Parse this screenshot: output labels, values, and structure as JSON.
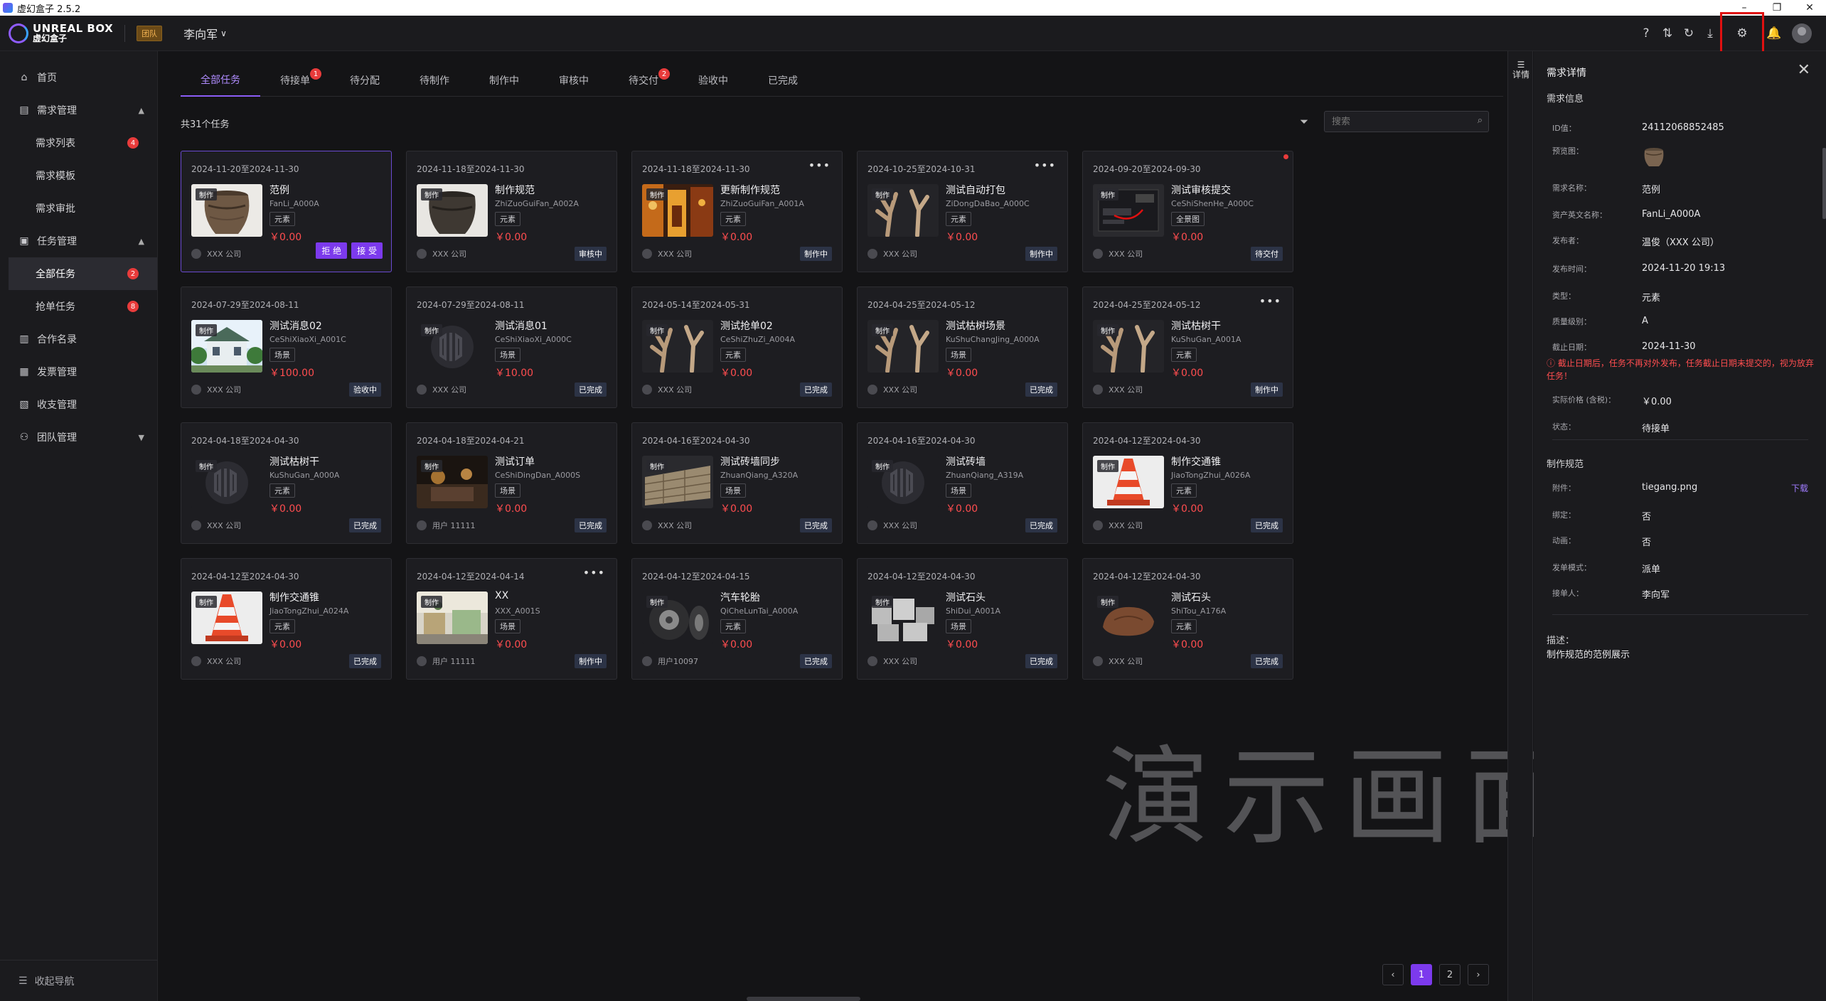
{
  "window": {
    "title": "虚幻盒子 2.5.2"
  },
  "header": {
    "logo_line1": "UNREAL BOX",
    "logo_line2": "虚幻盒子",
    "team_badge": "团队",
    "user_name": "李向军",
    "icons": [
      "help-icon",
      "sort-icon",
      "refresh-icon",
      "download-icon",
      "settings-icon",
      "bell-icon",
      "avatar"
    ]
  },
  "sidebar": {
    "items": [
      {
        "label": "首页",
        "icon": "home-icon"
      },
      {
        "label": "需求管理",
        "icon": "list-icon",
        "expanded": true
      },
      {
        "label": "需求列表",
        "badge": "4"
      },
      {
        "label": "需求模板"
      },
      {
        "label": "需求审批"
      },
      {
        "label": "任务管理",
        "icon": "task-icon",
        "expanded": true
      },
      {
        "label": "全部任务",
        "badge": "2",
        "active": true
      },
      {
        "label": "抢单任务",
        "badge": "8"
      },
      {
        "label": "合作名录",
        "icon": "book-icon"
      },
      {
        "label": "发票管理",
        "icon": "invoice-icon"
      },
      {
        "label": "收支管理",
        "icon": "wallet-icon"
      },
      {
        "label": "团队管理",
        "icon": "team-icon",
        "expanded": false
      }
    ],
    "collapse_label": "收起导航"
  },
  "tabs": [
    {
      "label": "全部任务",
      "active": true
    },
    {
      "label": "待接单",
      "badge": "1"
    },
    {
      "label": "待分配"
    },
    {
      "label": "待制作"
    },
    {
      "label": "制作中"
    },
    {
      "label": "审核中"
    },
    {
      "label": "待交付",
      "badge": "2"
    },
    {
      "label": "验收中"
    },
    {
      "label": "已完成"
    }
  ],
  "list": {
    "count_label": "共31个任务",
    "search_placeholder": "搜索",
    "tag_label": "制作",
    "cards": [
      {
        "date": "2024-11-20至2024-11-30",
        "name": "范例",
        "code": "FanLi_A000A",
        "category": "元素",
        "price": "￥0.00",
        "company": "XXX 公司",
        "actions": [
          "拒 绝",
          "接 受"
        ],
        "thumb": "jar"
      },
      {
        "date": "2024-11-18至2024-11-30",
        "name": "制作规范",
        "code": "ZhiZuoGuiFan_A002A",
        "category": "元素",
        "price": "￥0.00",
        "company": "XXX 公司",
        "status": "审核中",
        "thumb": "jar2"
      },
      {
        "date": "2024-11-18至2024-11-30",
        "name": "更新制作规范",
        "code": "ZhiZuoGuiFan_A001A",
        "category": "元素",
        "price": "￥0.00",
        "company": "XXX 公司",
        "status": "制作中",
        "more": true,
        "thumb": "temple"
      },
      {
        "date": "2024-10-25至2024-10-31",
        "name": "测试自动打包",
        "code": "ZiDongDaBao_A000C",
        "category": "元素",
        "price": "￥0.00",
        "company": "XXX 公司",
        "status": "制作中",
        "more": true,
        "thumb": "branch"
      },
      {
        "date": "2024-09-20至2024-09-30",
        "name": "测试审核提交",
        "code": "CeShiShenHe_A000C",
        "category": "全景图",
        "price": "￥0.00",
        "company": "XXX 公司",
        "status": "待交付",
        "dot": true,
        "thumb": "screen"
      },
      {
        "date": "2024-07-29至2024-08-11",
        "name": "测试消息02",
        "code": "CeShiXiaoXi_A001C",
        "category": "场景",
        "price": "￥100.00",
        "company": "XXX 公司",
        "status": "验收中",
        "thumb": "house"
      },
      {
        "date": "2024-07-29至2024-08-11",
        "name": "测试消息01",
        "code": "CeShiXiaoXi_A000C",
        "category": "场景",
        "price": "￥10.00",
        "company": "XXX 公司",
        "status": "已完成",
        "thumb": "placeholder"
      },
      {
        "date": "2024-05-14至2024-05-31",
        "name": "测试抢单02",
        "code": "CeShiZhuZi_A004A",
        "category": "元素",
        "price": "￥0.00",
        "company": "XXX 公司",
        "status": "已完成",
        "thumb": "branch"
      },
      {
        "date": "2024-04-25至2024-05-12",
        "name": "测试枯树场景",
        "code": "KuShuChangJing_A000A",
        "category": "场景",
        "price": "￥0.00",
        "company": "XXX 公司",
        "status": "已完成",
        "thumb": "branch"
      },
      {
        "date": "2024-04-25至2024-05-12",
        "name": "测试枯树干",
        "code": "KuShuGan_A001A",
        "category": "元素",
        "price": "￥0.00",
        "company": "XXX 公司",
        "status": "制作中",
        "more": true,
        "thumb": "branch"
      },
      {
        "date": "2024-04-18至2024-04-30",
        "name": "测试枯树干",
        "code": "KuShuGan_A000A",
        "category": "元素",
        "price": "￥0.00",
        "company": "XXX 公司",
        "status": "已完成",
        "thumb": "placeholder"
      },
      {
        "date": "2024-04-18至2024-04-21",
        "name": "测试订单",
        "code": "CeShiDingDan_A000S",
        "category": "场景",
        "price": "￥0.00",
        "company": "用户 11111",
        "status": "已完成",
        "thumb": "night"
      },
      {
        "date": "2024-04-16至2024-04-30",
        "name": "测试砖墙同步",
        "code": "ZhuanQiang_A320A",
        "category": "场景",
        "price": "￥0.00",
        "company": "XXX 公司",
        "status": "已完成",
        "thumb": "wall"
      },
      {
        "date": "2024-04-16至2024-04-30",
        "name": "测试砖墙",
        "code": "ZhuanQiang_A319A",
        "category": "场景",
        "price": "￥0.00",
        "company": "XXX 公司",
        "status": "已完成",
        "thumb": "placeholder"
      },
      {
        "date": "2024-04-12至2024-04-30",
        "name": "制作交通锥",
        "code": "JiaoTongZhui_A026A",
        "category": "元素",
        "price": "￥0.00",
        "company": "XXX 公司",
        "status": "已完成",
        "thumb": "cone"
      },
      {
        "date": "2024-04-12至2024-04-30",
        "name": "制作交通锥",
        "code": "JiaoTongZhui_A024A",
        "category": "元素",
        "price": "￥0.00",
        "company": "XXX 公司",
        "status": "已完成",
        "thumb": "cone"
      },
      {
        "date": "2024-04-12至2024-04-14",
        "name": "XX",
        "code": "XXX_A001S",
        "category": "场景",
        "price": "￥0.00",
        "company": "用户 11111",
        "status": "制作中",
        "more": true,
        "thumb": "market"
      },
      {
        "date": "2024-04-12至2024-04-15",
        "name": "汽车轮胎",
        "code": "QiCheLunTai_A000A",
        "category": "元素",
        "price": "￥0.00",
        "company": "用户10097",
        "status": "已完成",
        "thumb": "tire"
      },
      {
        "date": "2024-04-12至2024-04-30",
        "name": "测试石头",
        "code": "ShiDui_A001A",
        "category": "场景",
        "price": "￥0.00",
        "company": "XXX 公司",
        "status": "已完成",
        "thumb": "stones"
      },
      {
        "date": "2024-04-12至2024-04-30",
        "name": "测试石头",
        "code": "ShiTou_A176A",
        "category": "元素",
        "price": "￥0.00",
        "company": "XXX 公司",
        "status": "已完成",
        "thumb": "rock"
      }
    ]
  },
  "pagination": {
    "prev": "‹",
    "pages": [
      "1",
      "2"
    ],
    "current": "1",
    "next": "›"
  },
  "watermark": "演示画面",
  "detail": {
    "toggle_label": "详情",
    "title": "需求详情",
    "section_info": "需求信息",
    "rows": [
      {
        "k": "ID值：",
        "v": "24112068852485"
      },
      {
        "k": "预览图：",
        "v": ""
      },
      {
        "k": "需求名称：",
        "v": "范例"
      },
      {
        "k": "资产英文名称：",
        "v": "FanLi_A000A"
      },
      {
        "k": "发布者：",
        "v": "温俊（XXX 公司）"
      },
      {
        "k": "发布时间：",
        "v": "2024-11-20 19:13"
      },
      {
        "k": "类型：",
        "v": "元素"
      },
      {
        "k": "质量级别：",
        "v": "A"
      },
      {
        "k": "截止日期：",
        "v": "2024-11-30"
      }
    ],
    "warning": "ⓘ 截止日期后，任务不再对外发布，任务截止日期未提交的，视为放弃任务！",
    "price_row": {
      "k": "实际价格 (含税)：",
      "v": "￥0.00"
    },
    "status_row": {
      "k": "状态：",
      "v": "待接单"
    },
    "section_spec": "制作规范",
    "spec_rows": [
      {
        "k": "附件：",
        "v": "tiegang.png",
        "link": "下载"
      },
      {
        "k": "绑定：",
        "v": "否"
      },
      {
        "k": "动画：",
        "v": "否"
      },
      {
        "k": "发单模式：",
        "v": "派单"
      },
      {
        "k": "接单人：",
        "v": "李向军"
      }
    ],
    "desc_label": "描述：",
    "desc_value": "制作规范的范例展示"
  }
}
